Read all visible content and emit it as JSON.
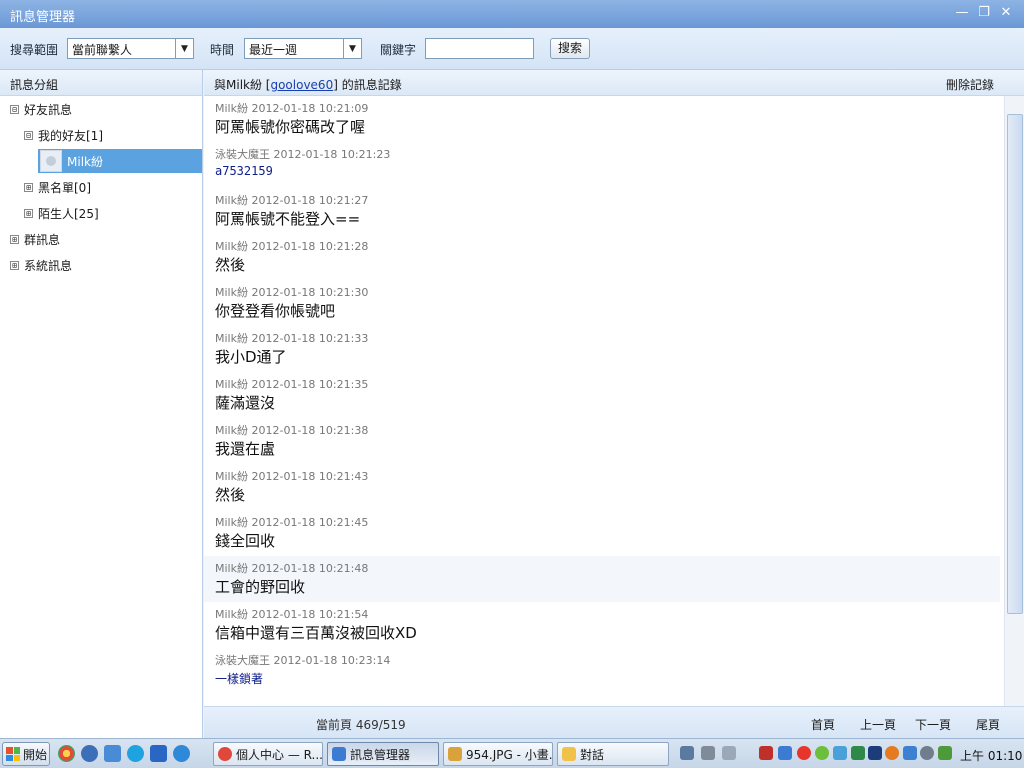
{
  "window": {
    "title": "訊息管理器"
  },
  "toolbar": {
    "search_scope_label": "搜尋範圍",
    "search_scope_value": "當前聯繫人",
    "time_label": "時間",
    "time_value": "最近一週",
    "keyword_label": "關鍵字",
    "keyword_value": "",
    "search_button": "搜索"
  },
  "sidebar": {
    "header": "訊息分組",
    "nodes": [
      {
        "label": "好友訊息",
        "expander": "⊟"
      },
      {
        "label": "我的好友[1]",
        "expander": "⊟"
      },
      {
        "label": "Milk紛"
      },
      {
        "label": "黑名單[0]",
        "expander": "⊞"
      },
      {
        "label": "陌生人[25]",
        "expander": "⊞"
      },
      {
        "label": "群訊息",
        "expander": "⊞"
      },
      {
        "label": "系統訊息",
        "expander": "⊞"
      }
    ]
  },
  "main": {
    "header_prefix": "與Milk紛 [",
    "header_link": "goolove60",
    "header_suffix": "] 的訊息記錄",
    "delete_label": "刪除記錄",
    "messages": [
      {
        "sender": "Milk紛",
        "time": "2012-01-18 10:21:09",
        "text": "阿罵帳號你密碼改了喔"
      },
      {
        "sender": "泳裝大魔王",
        "time": "2012-01-18 10:21:23",
        "text": "a7532159"
      },
      {
        "sender": "Milk紛",
        "time": "2012-01-18 10:21:27",
        "text": "阿罵帳號不能登入=="
      },
      {
        "sender": "Milk紛",
        "time": "2012-01-18 10:21:28",
        "text": "然後"
      },
      {
        "sender": "Milk紛",
        "time": "2012-01-18 10:21:30",
        "text": "你登登看你帳號吧"
      },
      {
        "sender": "Milk紛",
        "time": "2012-01-18 10:21:33",
        "text": "我小D通了"
      },
      {
        "sender": "Milk紛",
        "time": "2012-01-18 10:21:35",
        "text": "薩滿還沒"
      },
      {
        "sender": "Milk紛",
        "time": "2012-01-18 10:21:38",
        "text": "我還在盧"
      },
      {
        "sender": "Milk紛",
        "time": "2012-01-18 10:21:43",
        "text": "然後"
      },
      {
        "sender": "Milk紛",
        "time": "2012-01-18 10:21:45",
        "text": "錢全回收"
      },
      {
        "sender": "Milk紛",
        "time": "2012-01-18 10:21:48",
        "text": "工會的野回收"
      },
      {
        "sender": "Milk紛",
        "time": "2012-01-18 10:21:54",
        "text": "信箱中還有三百萬沒被回收XD"
      },
      {
        "sender": "泳裝大魔王",
        "time": "2012-01-18 10:23:14",
        "text": "一樣鎖著"
      }
    ],
    "pager": {
      "current": "當前頁 469/519",
      "first": "首頁",
      "prev": "上一頁",
      "next": "下一頁",
      "last": "尾頁"
    }
  },
  "taskbar": {
    "start": "開始",
    "tasks": [
      {
        "label": "個人中心 — R...",
        "icon_color": "#e0483c"
      },
      {
        "label": "訊息管理器",
        "icon_color": "#3b7bd1"
      },
      {
        "label": "954.JPG - 小畫...",
        "icon_color": "#d9a23a"
      },
      {
        "label": "對話",
        "icon_color": "#f0c24a"
      }
    ],
    "clock": "上午 01:10"
  },
  "colors": {
    "accent": "#5aa2e0",
    "titlebar": "#7aa6dd",
    "link": "#1a3fb0"
  }
}
